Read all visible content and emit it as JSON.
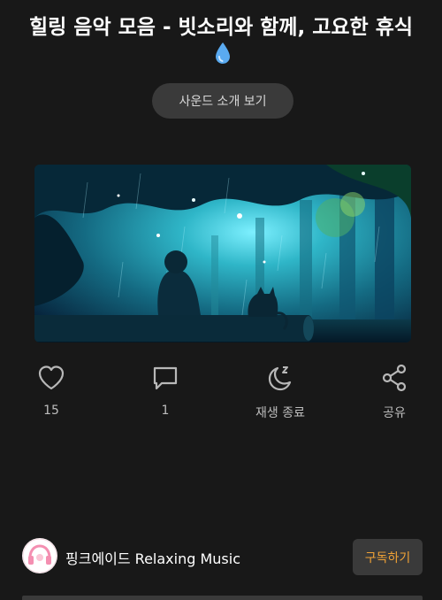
{
  "header": {
    "title": "힐링 음악 모음 - 빗소리와 함께, 고요한 휴식",
    "title_icon": "water-drop-icon"
  },
  "sound_intro_button": {
    "label": "사운드 소개 보기"
  },
  "artwork": {
    "icon": "rainy-forest-cat-illustration"
  },
  "actions": {
    "like": {
      "icon": "heart-outline-icon",
      "label": "15"
    },
    "comment": {
      "icon": "speech-bubble-icon",
      "label": "1"
    },
    "sleep_timer": {
      "icon": "moon-zz-icon",
      "label": "재생 종료"
    },
    "share": {
      "icon": "share-nodes-icon",
      "label": "공유"
    }
  },
  "channel": {
    "name": "핑크에이드 Relaxing Music",
    "subscribe_label": "구독하기",
    "avatar_icon": "pink-headphones-avatar"
  },
  "colors": {
    "background": "#181818",
    "button_bg": "#3a3a3a",
    "icon_gray": "#b8b8b8",
    "subscribe_text": "#f0a236"
  }
}
